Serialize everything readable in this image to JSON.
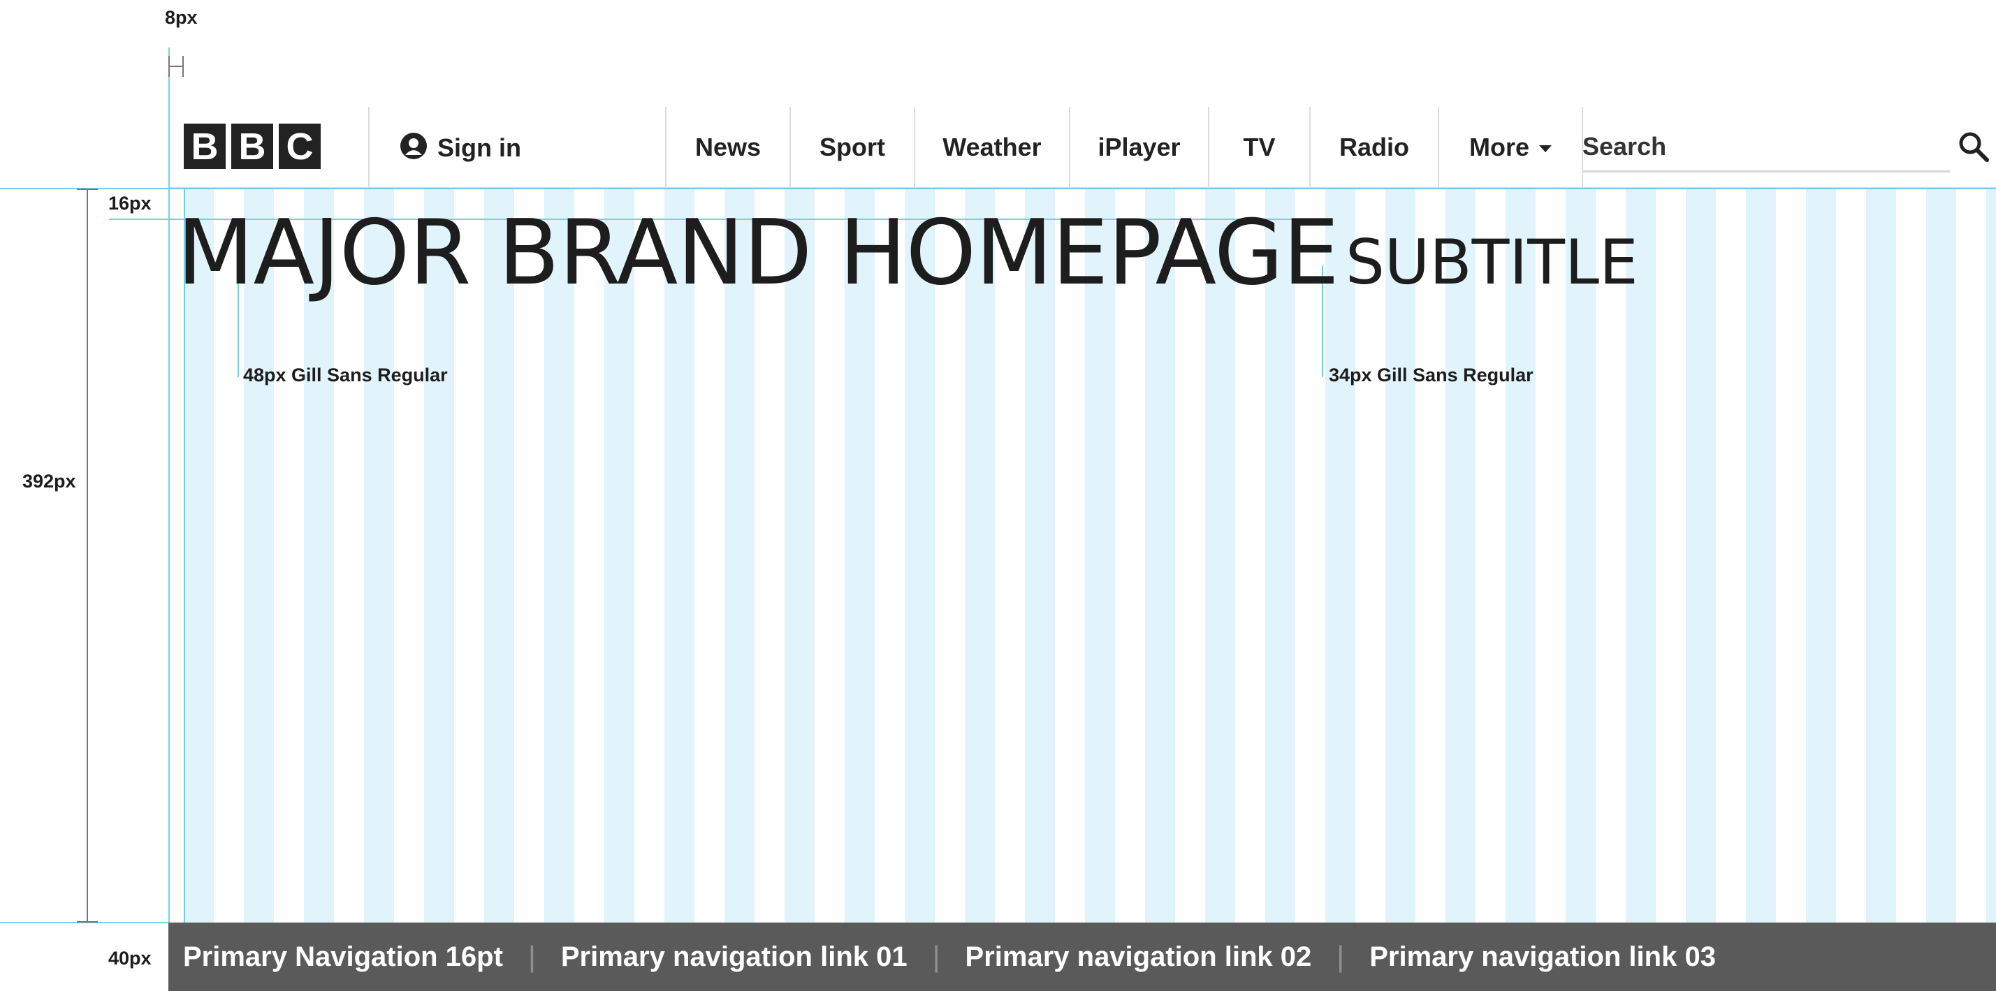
{
  "annotations": {
    "gutter_label": "8px",
    "top_margin_label": "16px",
    "masthead_height_label": "392px",
    "nav_height_label": "40px",
    "title_font_note": "48px Gill Sans Regular",
    "subtitle_font_note": "34px Gill Sans Regular"
  },
  "masthead": {
    "logo_letters": [
      "B",
      "B",
      "C"
    ],
    "sign_in_label": "Sign in",
    "nav_items": [
      "News",
      "Sport",
      "Weather",
      "iPlayer",
      "TV",
      "Radio"
    ],
    "more_label": "More",
    "search_placeholder": "Search"
  },
  "headline": {
    "title": "MAJOR BRAND HOMEPAGE",
    "subtitle": "SUBTITLE"
  },
  "primary_nav": {
    "title": "Primary Navigation 16pt",
    "links": [
      "Primary navigation link 01",
      "Primary navigation link 02",
      "Primary navigation link 03"
    ],
    "divider": "|"
  },
  "colors": {
    "grid_column": "#e1f3fb",
    "guide_line": "#6fd0ea",
    "nav_bar": "#5a5a5a",
    "logo_block": "#222222"
  }
}
